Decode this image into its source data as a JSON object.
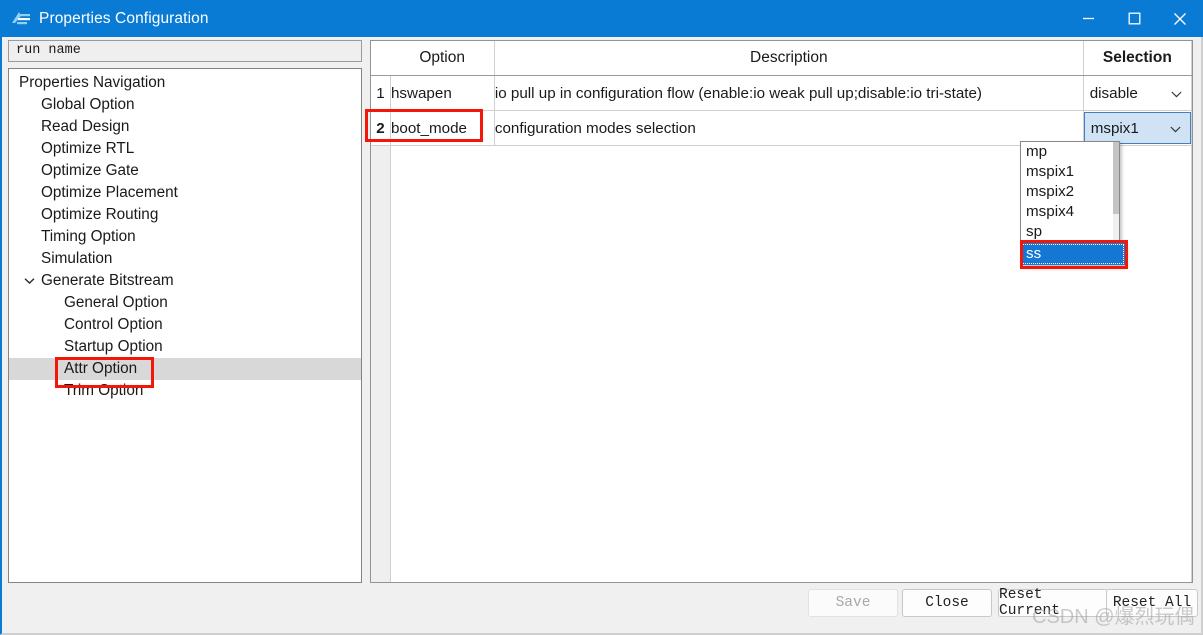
{
  "window": {
    "title": "Properties Configuration",
    "app_icon": "app-logo-icon",
    "controls": {
      "minimize": "minimize-icon",
      "maximize": "maximize-icon",
      "close": "close-icon"
    },
    "accent_color": "#0a7bd4"
  },
  "left_panel": {
    "run_name_field": {
      "value": "run name"
    },
    "tree": {
      "root_label": "Properties Navigation",
      "items": [
        {
          "label": "Global Option",
          "level": 1,
          "selected": false,
          "expandable": false
        },
        {
          "label": "Read Design",
          "level": 1,
          "selected": false,
          "expandable": false
        },
        {
          "label": "Optimize RTL",
          "level": 1,
          "selected": false,
          "expandable": false
        },
        {
          "label": "Optimize Gate",
          "level": 1,
          "selected": false,
          "expandable": false
        },
        {
          "label": "Optimize Placement",
          "level": 1,
          "selected": false,
          "expandable": false
        },
        {
          "label": "Optimize Routing",
          "level": 1,
          "selected": false,
          "expandable": false
        },
        {
          "label": "Timing Option",
          "level": 1,
          "selected": false,
          "expandable": false
        },
        {
          "label": "Simulation",
          "level": 1,
          "selected": false,
          "expandable": false
        },
        {
          "label": "Generate Bitstream",
          "level": 1,
          "selected": false,
          "expandable": true,
          "expanded": true
        },
        {
          "label": "General Option",
          "level": 2,
          "selected": false,
          "expandable": false
        },
        {
          "label": "Control Option",
          "level": 2,
          "selected": false,
          "expandable": false
        },
        {
          "label": "Startup Option",
          "level": 2,
          "selected": false,
          "expandable": false
        },
        {
          "label": "Attr Option",
          "level": 2,
          "selected": true,
          "expandable": false
        },
        {
          "label": "Trim Option",
          "level": 2,
          "selected": false,
          "expandable": false
        }
      ]
    }
  },
  "table": {
    "headers": {
      "gutter": "",
      "option": "Option",
      "description": "Description",
      "selection": "Selection"
    },
    "rows": [
      {
        "num": "1",
        "option": "hswapen",
        "description": "io pull up in configuration flow (enable:io weak pull up;disable:io tri-state)",
        "selection": "disable",
        "open": false
      },
      {
        "num": "2",
        "option": "boot_mode",
        "description": "configuration modes selection",
        "selection": "mspix1",
        "open": true
      }
    ]
  },
  "dropdown": {
    "options": [
      "mp",
      "mspix1",
      "mspix2",
      "mspix4",
      "sp"
    ],
    "highlighted": "ss"
  },
  "buttons": {
    "save": "Save",
    "close": "Close",
    "reset_current": "Reset Current",
    "reset_all": "Reset All"
  },
  "watermark": {
    "text": "CSDN @爆烈玩偶"
  }
}
